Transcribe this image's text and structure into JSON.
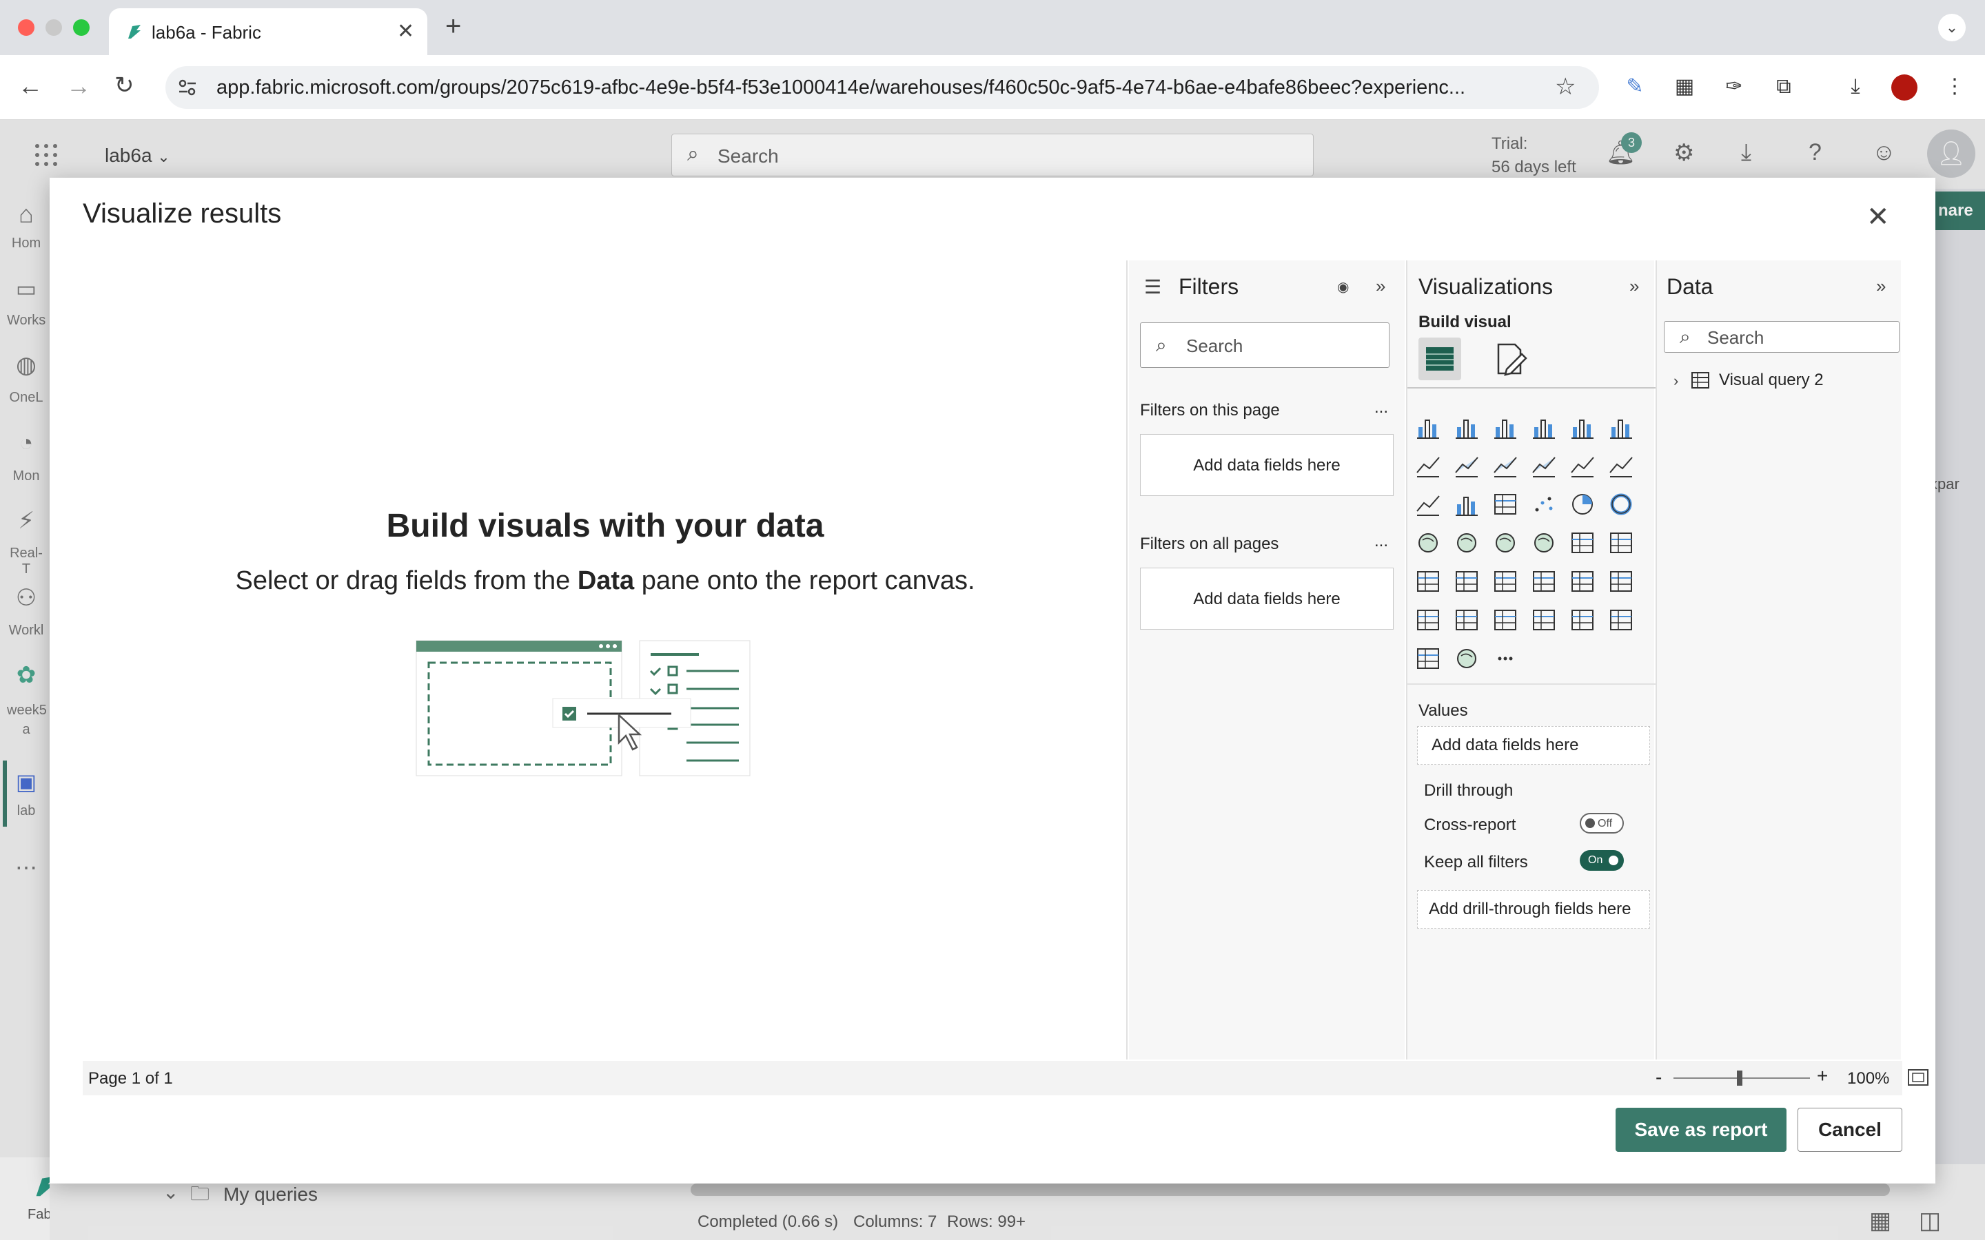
{
  "browser": {
    "tab_title": "lab6a - Fabric",
    "url": "app.fabric.microsoft.com/groups/2075c619-afbc-4e9e-b5f4-f53e1000414e/warehouses/f460c50c-9af5-4e74-b6ae-e4bafe86beec?experienc..."
  },
  "app": {
    "workspace": "lab6a",
    "search_placeholder": "Search",
    "trial_line1": "Trial:",
    "trial_line2": "56 days left",
    "notification_count": "3",
    "share_partial": "nare",
    "rail": [
      "Hom",
      "Works",
      "OneL",
      "Mon",
      "Real-T",
      "Workl",
      "week5",
      "a",
      "lab",
      "Fabric"
    ],
    "bottom": {
      "my_queries": "My queries",
      "status": "Completed (0.66 s)",
      "columns": "Columns: 7",
      "rows": "Rows: 99+",
      "expand_partial": "xpar"
    }
  },
  "modal": {
    "title": "Visualize results",
    "canvas_title": "Build visuals with your data",
    "canvas_sub_pre": "Select or drag fields from the ",
    "canvas_sub_bold": "Data",
    "canvas_sub_post": " pane onto the report canvas.",
    "filters": {
      "title": "Filters",
      "search_placeholder": "Search",
      "this_page": "Filters on this page",
      "all_pages": "Filters on all pages",
      "add_fields": "Add data fields here",
      "more": "..."
    },
    "visualizations": {
      "title": "Visualizations",
      "build_visual": "Build visual",
      "values": "Values",
      "add_fields": "Add data fields here",
      "drill_through": "Drill through",
      "cross_report": "Cross-report",
      "cross_report_state": "Off",
      "keep_all_filters": "Keep all filters",
      "keep_all_filters_state": "On",
      "add_drill": "Add drill-through fields here",
      "more": "..."
    },
    "data": {
      "title": "Data",
      "search_placeholder": "Search",
      "item": "Visual query 2"
    },
    "footer": {
      "page": "Page 1 of 1",
      "zoom_minus": "-",
      "zoom_plus": "+",
      "zoom": "100%"
    },
    "save_label": "Save as report",
    "cancel_label": "Cancel"
  }
}
